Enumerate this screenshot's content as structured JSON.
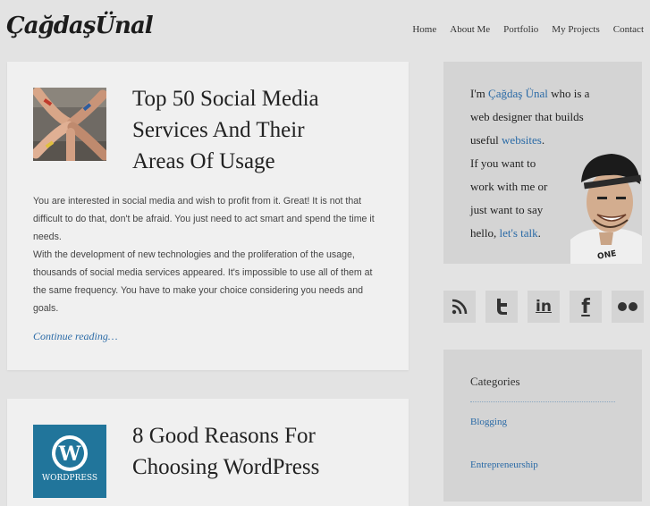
{
  "site": {
    "logo": "ÇağdaşÜnal"
  },
  "nav": [
    "Home",
    "About Me",
    "Portfolio",
    "My Projects",
    "Contact"
  ],
  "posts": [
    {
      "title_lines": [
        "Top 50 Social Media",
        "Services And Their",
        "Areas Of Usage"
      ],
      "paragraph1_lines": [
        "You are interested in social media and wish to profit from it. Great! It is not that",
        "difficult to do that, don't be afraid. You just need to act smart and spend the time it",
        "needs."
      ],
      "paragraph2_lines": [
        "With the development of new technologies and the proliferation of the usage,",
        "thousands of social media services appeared. It's impossible to use all of them at",
        "the same frequency. You have to make your choice considering you needs and",
        "goals."
      ],
      "more": "Continue reading…"
    },
    {
      "title_lines": [
        "8 Good Reasons For",
        "Choosing WordPress"
      ],
      "thumb_label": "WORDPRESS"
    }
  ],
  "about": {
    "l1_pre": "I'm ",
    "l1_link": "Çağdaş Ünal",
    "l1_post": " who is a",
    "l2": "web designer that builds",
    "l3_pre": "useful ",
    "l3_link": "websites",
    "l3_post": ".",
    "l4": "If you want to",
    "l5": "work with me or",
    "l6": "just want to say",
    "l7_pre": "hello, ",
    "l7_link": "let's talk",
    "l7_post": "."
  },
  "social": [
    "rss-icon",
    "twitter-icon",
    "linkedin-icon",
    "facebook-icon",
    "flickr-icon"
  ],
  "categories": {
    "title": "Categories",
    "items": [
      "Blogging",
      "Entrepreneurship"
    ]
  },
  "colors": {
    "link": "#2a6aa6",
    "wordpress_blue": "#21759b"
  }
}
